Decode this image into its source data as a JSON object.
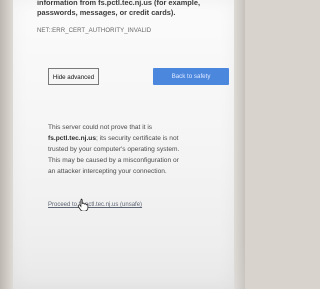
{
  "page": {
    "top_text_line_1": "information from fs.pctl.tec.nj.us (for example,",
    "top_text_line_2": "passwords, messages, or credit cards).",
    "error_code": "NET::ERR_CERT_AUTHORITY_INVALID"
  },
  "buttons": {
    "hide_advanced": "Hide advanced",
    "back_to_safety": "Back to safety"
  },
  "advanced": {
    "message_line_1_prefix": "This server could not prove that it is",
    "domain": "fs.pctl.tec.nj.us",
    "message_line_2_suffix": "; its security certificate is not",
    "message_line_3": "trusted by your computer's operating system.",
    "message_line_4": "This may be caused by a misconfiguration or",
    "message_line_5": "an attacker intercepting your connection.",
    "proceed_link": "Proceed to fs.pctl.tec.nj.us (unsafe)"
  },
  "icons": {
    "pointer": "hand-pointer-icon"
  },
  "colors": {
    "primary_button": "#4c87de",
    "link": "#5d6473",
    "background": "#f4f4f4"
  }
}
